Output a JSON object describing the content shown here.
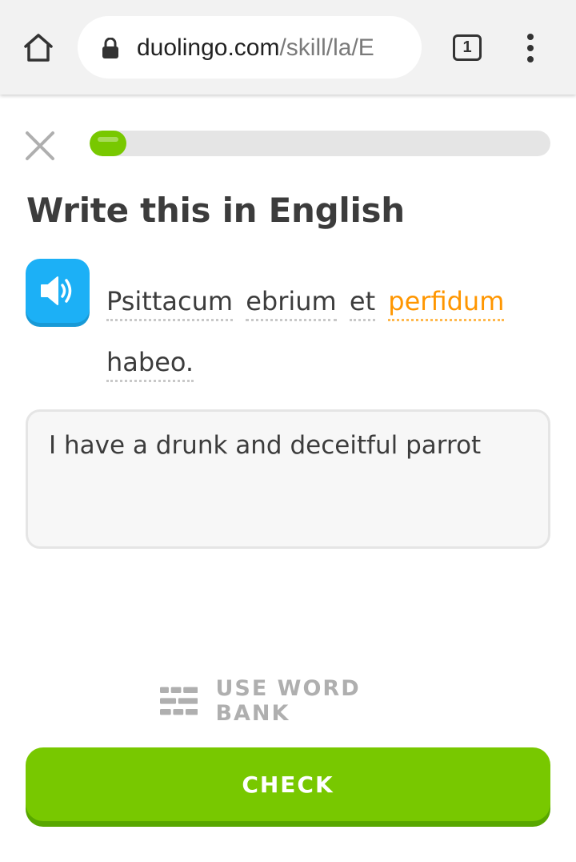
{
  "browser": {
    "url_domain": "duolingo.com",
    "url_path": "/skill/la/E",
    "tab_count": "1"
  },
  "lesson": {
    "progress": 0.08,
    "prompt_title": "Write this in English",
    "sentence_words": [
      {
        "text": "Psittacum",
        "highlight": false
      },
      {
        "text": "ebrium",
        "highlight": false
      },
      {
        "text": "et",
        "highlight": false
      },
      {
        "text": "perfidum",
        "highlight": true
      },
      {
        "text": "habeo.",
        "highlight": false
      }
    ],
    "answer_value": "I have a drunk and deceitful parrot",
    "word_bank_label": "USE WORD BANK",
    "check_label": "CHECK"
  },
  "colors": {
    "accent_green": "#78c800",
    "speaker_blue": "#1cb0f6",
    "highlight_orange": "#ff9600"
  },
  "icons": [
    "home-icon",
    "lock-icon",
    "more-vert-icon",
    "close-icon",
    "speaker-icon",
    "word-bank-icon"
  ]
}
